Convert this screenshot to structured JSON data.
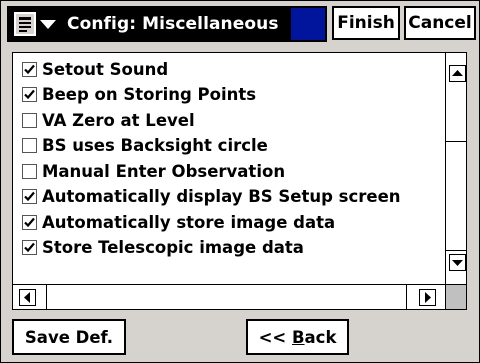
{
  "titlebar": {
    "menu_icon": "document-menu-icon",
    "title": "Config: Miscellaneous",
    "finish_label": "Finish",
    "cancel_label": "Cancel"
  },
  "options": [
    {
      "label": "Setout Sound",
      "checked": true
    },
    {
      "label": "Beep on Storing Points",
      "checked": true
    },
    {
      "label": "VA Zero at Level",
      "checked": false
    },
    {
      "label": "BS uses Backsight circle",
      "checked": false
    },
    {
      "label": "Manual Enter Observation",
      "checked": false
    },
    {
      "label": "Automatically display BS Setup screen",
      "checked": true
    },
    {
      "label": "Automatically store image data",
      "checked": true
    },
    {
      "label": "Store Telescopic image data",
      "checked": true
    }
  ],
  "footer": {
    "save_default_label": "Save Def.",
    "back_prefix": "<< ",
    "back_mnemonic": "B",
    "back_rest": "ack"
  },
  "colors": {
    "title_bg": "#000000",
    "title_accent": "#00149c",
    "window_bg": "#d6d3ce"
  }
}
